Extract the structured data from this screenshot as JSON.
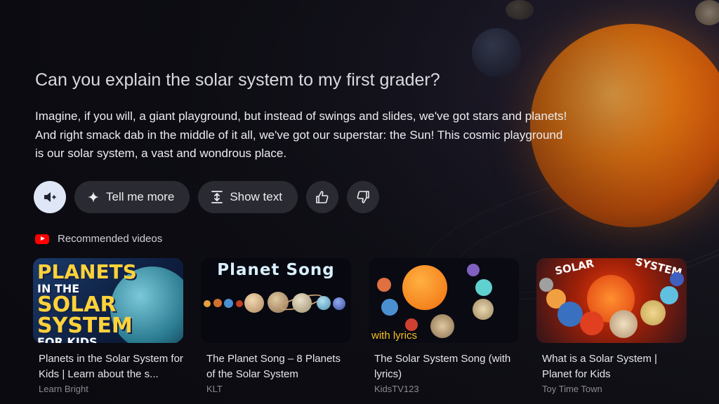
{
  "question": "Can you explain the solar system to my first grader?",
  "answer": "Imagine, if you will, a giant playground, but instead of swings and slides, we've got stars and planets! And right smack dab in the middle of it all, we've got our superstar: the Sun! This cosmic playground is our solar system, a vast and wondrous place.",
  "actions": {
    "audio_icon": "speaker-icon",
    "tell_more_label": "Tell me more",
    "tell_more_icon": "sparkle-icon",
    "show_text_label": "Show text",
    "show_text_icon": "expand-text-icon",
    "like_icon": "thumbs-up-icon",
    "dislike_icon": "thumbs-down-icon"
  },
  "recommended": {
    "label": "Recommended videos",
    "icon": "youtube-icon"
  },
  "videos": [
    {
      "title": "Planets in the Solar System for Kids | Learn about the s...",
      "channel": "Learn Bright",
      "thumb_text": [
        "PLANETS",
        "IN THE",
        "SOLAR",
        "SYSTEM",
        "FOR KIDS"
      ]
    },
    {
      "title": "The Planet Song – 8 Planets of the Solar System",
      "channel": "KLT",
      "thumb_text": [
        "Planet Song"
      ]
    },
    {
      "title": "The Solar System Song (with lyrics)",
      "channel": "KidsTV123",
      "thumb_text": [
        "with lyrics"
      ]
    },
    {
      "title": "What is a Solar System | Planet for Kids",
      "channel": "Toy Time Town",
      "thumb_text": [
        "SOLAR",
        "SYSTEM"
      ]
    }
  ],
  "colors": {
    "accent_active": "#dfe6f6",
    "pill_bg": "#2a2a32",
    "youtube_red": "#ff0000"
  }
}
